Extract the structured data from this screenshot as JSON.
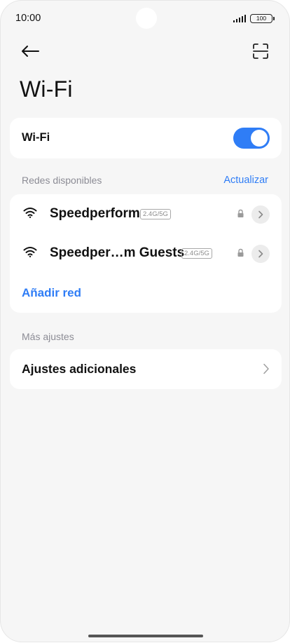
{
  "status_bar": {
    "time": "10:00",
    "battery": "100"
  },
  "header": {
    "title": "Wi-Fi",
    "back_icon": "arrow-left-icon",
    "scan_icon": "qr-scan-icon"
  },
  "wifi_toggle": {
    "label": "Wi-Fi",
    "enabled": true
  },
  "available_networks": {
    "section_label": "Redes disponibles",
    "refresh_label": "Actualizar",
    "networks": [
      {
        "name": "Speedperform",
        "band": "2.4G/5G",
        "secured": true
      },
      {
        "name": "Speedper…m Guests",
        "band": "2.4G/5G",
        "secured": true
      }
    ],
    "add_network_label": "Añadir red"
  },
  "more_settings": {
    "section_label": "Más ajustes",
    "items": [
      {
        "label": "Ajustes adicionales"
      }
    ]
  },
  "colors": {
    "accent": "#2f7df6",
    "background": "#f6f6f6",
    "card": "#ffffff",
    "section_text": "#8c8c95"
  }
}
